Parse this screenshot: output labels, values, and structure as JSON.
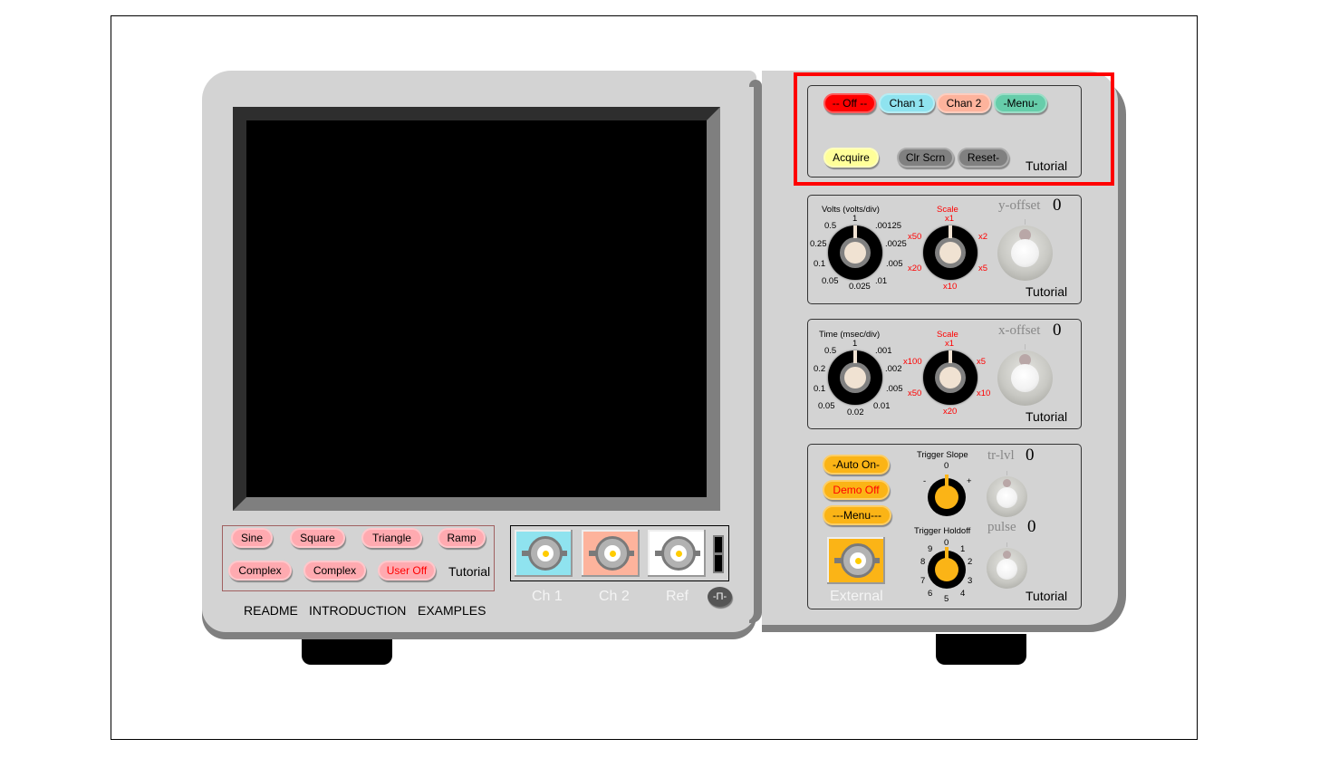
{
  "colors": {
    "chassis": "#d3d3d3",
    "chassis_shadow": "#808080",
    "highlight_box": "#ff0000",
    "off_button": "#ff0000",
    "chan1": "#8fe3ef",
    "chan2": "#fdb39c",
    "menu": "#66cdaa",
    "acquire": "#ffff99",
    "gray_button": "#808080",
    "wave_button": "#ffaab0",
    "trigger_button": "#fbb416"
  },
  "control_panel": {
    "off_label": "-- Off --",
    "chan1_label": "Chan 1",
    "chan2_label": "Chan 2",
    "menu_label": "-Menu-",
    "acquire_label": "Acquire",
    "clr_scrn_label": "Clr Scrn",
    "reset_label": "Reset-",
    "tutorial_label": "Tutorial"
  },
  "volts_panel": {
    "title": "Volts (volts/div)",
    "dial_labels": [
      "1",
      ".00125",
      ".0025",
      ".005",
      ".01",
      "0.025",
      "0.05",
      "0.1",
      "0.25",
      "0.5"
    ],
    "scale_title": "Scale",
    "scale_labels": [
      "x1",
      "x2",
      "x5",
      "x10",
      "x20",
      "x50"
    ],
    "offset_label": "y-offset",
    "offset_value": "0",
    "tutorial_label": "Tutorial"
  },
  "time_panel": {
    "title": "Time (msec/div)",
    "dial_labels": [
      "1",
      ".001",
      ".002",
      ".005",
      "0.01",
      "0.02",
      "0.05",
      "0.1",
      "0.2",
      "0.5"
    ],
    "scale_title": "Scale",
    "scale_labels": [
      "x1",
      "x5",
      "x10",
      "x20",
      "x50",
      "x100"
    ],
    "offset_label": "x-offset",
    "offset_value": "0",
    "tutorial_label": "Tutorial"
  },
  "trigger_panel": {
    "auto_label": "-Auto On-",
    "demo_label": "Demo Off",
    "menu_label": "---Menu---",
    "external_label": "External",
    "slope_title": "Trigger Slope",
    "slope_labels": [
      "0",
      "-",
      "+"
    ],
    "holdoff_title": "Trigger Holdoff",
    "holdoff_labels": [
      "0",
      "1",
      "2",
      "3",
      "4",
      "5",
      "6",
      "7",
      "8",
      "9"
    ],
    "trlvl_label": "tr-lvl",
    "trlvl_value": "0",
    "pulse_label": "pulse",
    "pulse_value": "0",
    "tutorial_label": "Tutorial"
  },
  "waveforms": {
    "buttons": [
      "Sine",
      "Square",
      "Triangle",
      "Ramp",
      "Complex",
      "Complex",
      "User Off"
    ],
    "tutorial_label": "Tutorial"
  },
  "inputs": {
    "ch1_label": "Ch 1",
    "ch2_label": "Ch 2",
    "ref_label": "Ref",
    "pulse_button_label": "-Π-"
  },
  "links": {
    "readme": "README",
    "introduction": "INTRODUCTION",
    "examples": "EXAMPLES"
  }
}
